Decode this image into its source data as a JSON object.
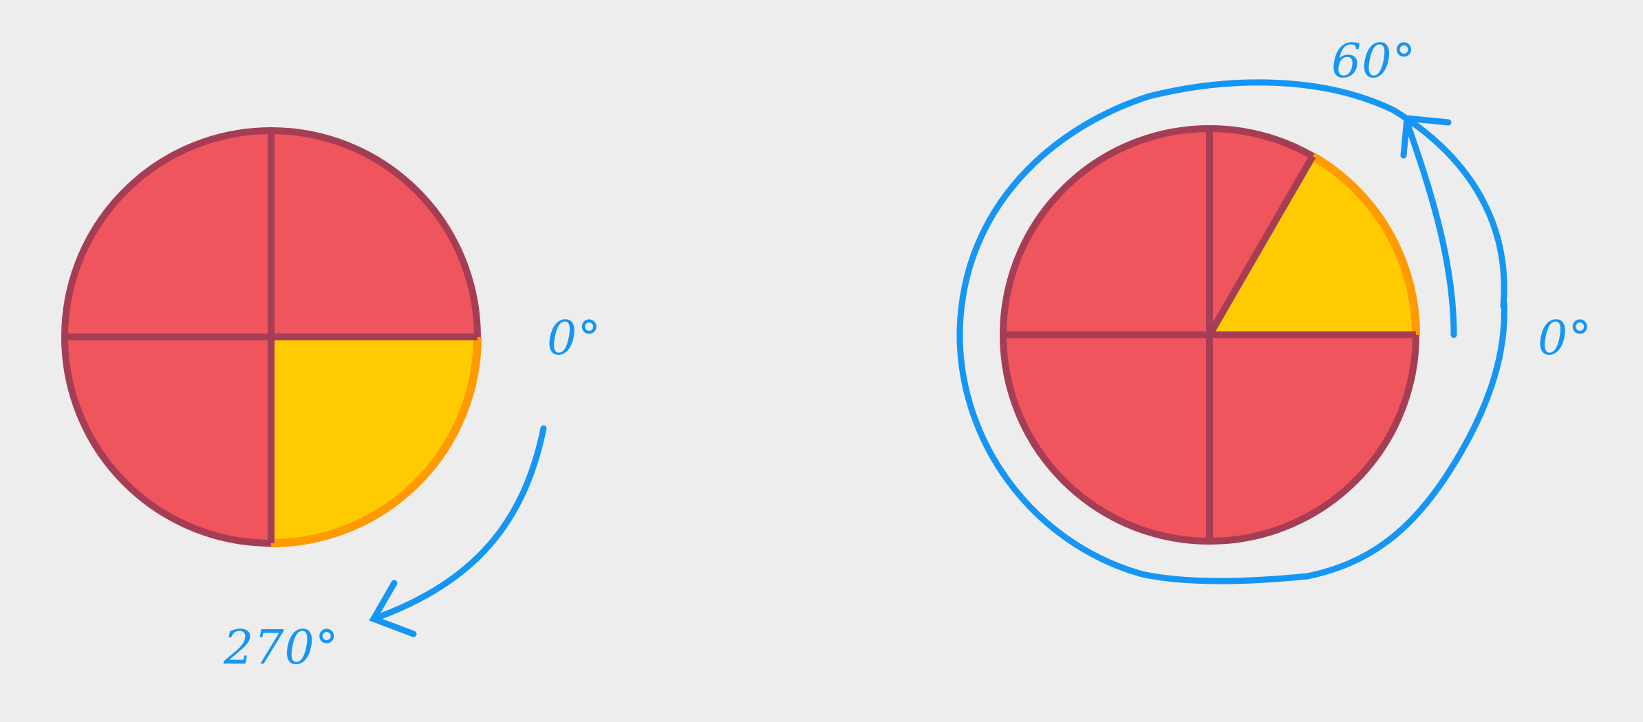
{
  "colors": {
    "background": "#eeeded",
    "slice_fill": "#f0545c",
    "slice_stroke": "#a53e55",
    "highlight_fill": "#ffcb00",
    "highlight_edge": "#ff9a00",
    "annotation": "#1596f5"
  },
  "left_diagram": {
    "divisions": 4,
    "highlight_start_deg": 0,
    "highlight_end_deg": 270,
    "direction": "clockwise",
    "start_label": "0°",
    "end_label": "270°"
  },
  "right_diagram": {
    "divisions": 4,
    "highlight_start_deg": 0,
    "highlight_end_deg": 60,
    "direction": "counterclockwise",
    "start_label": "0°",
    "end_label": "60°"
  }
}
